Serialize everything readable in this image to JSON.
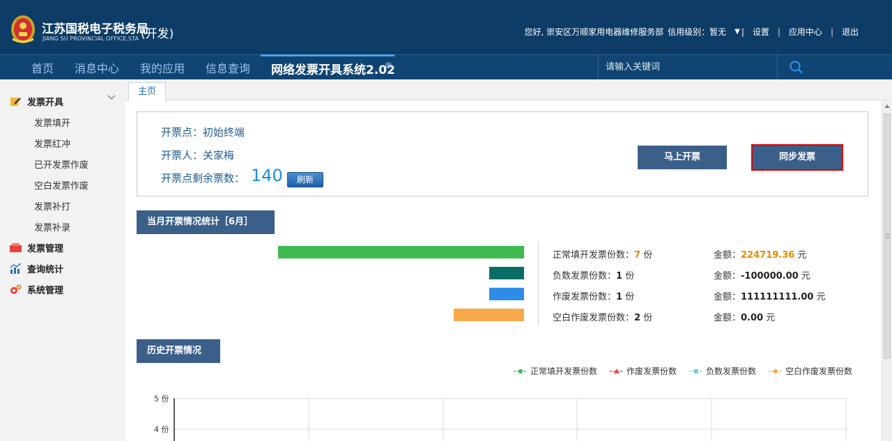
{
  "header": {
    "title": "江苏国税电子税务局",
    "subtitle": "JIANG SU PROVINCIAL OFFICE.STA",
    "env": "(开发)",
    "user_greeting": "您好, 崇安区万顺家用电器维修服务部",
    "credit_level": "信用级别：暂无",
    "links": {
      "settings": "设置",
      "app_center": "应用中心",
      "logout": "退出"
    }
  },
  "nav": {
    "items": [
      "首页",
      "消息中心",
      "我的应用",
      "信息查询"
    ],
    "active": "网络发票开具系统2.02",
    "search_placeholder": "请输入关键词"
  },
  "sidebar": {
    "invoice_issue": "发票开具",
    "invoice_issue_items": [
      "发票填开",
      "发票红冲",
      "已开发票作废",
      "空白发票作废",
      "发票补打",
      "发票补录"
    ],
    "invoice_manage": "发票管理",
    "query_stats": "查询统计",
    "system_manage": "系统管理"
  },
  "tabs": {
    "home": "主页"
  },
  "info": {
    "point_label": "开票点：初始终端",
    "issuer_label": "开票人：关家梅",
    "remain_label": "开票点剩余票数：",
    "remain_count": "140",
    "refresh": "刷新",
    "issue_now": "马上开票",
    "sync": "同步发票"
  },
  "month_stats": {
    "title": "当月开票情况统计［6月］",
    "colors": {
      "normal": "#3dbb4f",
      "negative": "#0b6e66",
      "void": "#2f8ce8",
      "blank_void": "#f7a94b"
    },
    "rows": [
      {
        "label": "正常填开发票份数：",
        "count": "7",
        "unit": "份",
        "amount_label": "金额：",
        "amount": "224719.36",
        "amount_unit": "元",
        "fraction": 1.0
      },
      {
        "label": "负数发票份数：",
        "count": "1",
        "unit": "份",
        "amount_label": "金额：",
        "amount": "-100000.00",
        "amount_unit": "元",
        "fraction": 0.143
      },
      {
        "label": "作废发票份数：",
        "count": "1",
        "unit": "份",
        "amount_label": "金额：",
        "amount": "111111111.00",
        "amount_unit": "元",
        "fraction": 0.143
      },
      {
        "label": "空白作废发票份数：",
        "count": "2",
        "unit": "份",
        "amount_label": "金额：",
        "amount": "0.00",
        "amount_unit": "元",
        "fraction": 0.286
      }
    ]
  },
  "history": {
    "title": "历史开票情况",
    "legend": [
      "正常填开发票份数",
      "作废发票份数",
      "负数发票份数",
      "空白作废发票份数"
    ],
    "legend_colors": [
      "#3dbb4f",
      "#e84c4c",
      "#7fc4e8",
      "#f7a94b"
    ],
    "y_ticks": [
      "5 份",
      "4 份"
    ]
  }
}
